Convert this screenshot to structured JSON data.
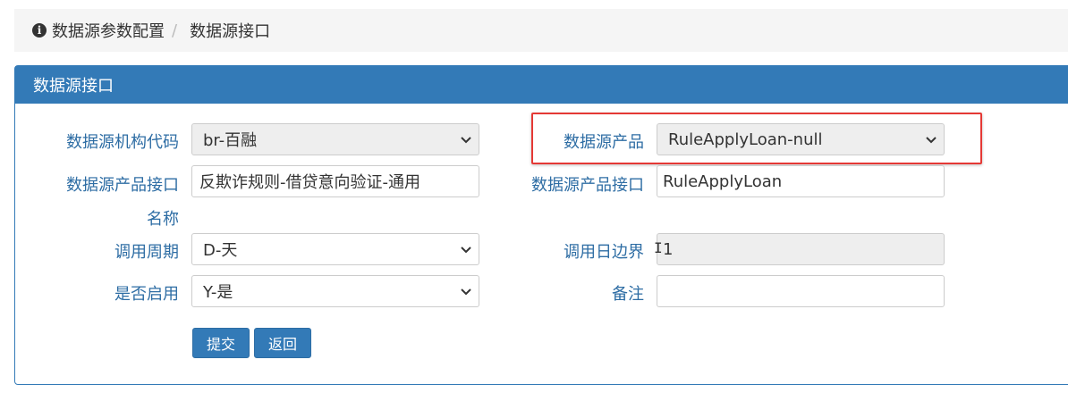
{
  "breadcrumb": {
    "parent": "数据源参数配置",
    "separator": "/",
    "current": "数据源接口"
  },
  "panel": {
    "title": "数据源接口"
  },
  "form": {
    "org_code": {
      "label": "数据源机构代码",
      "value": "br-百融"
    },
    "product": {
      "label": "数据源产品",
      "value": "RuleApplyLoan-null"
    },
    "interface_name": {
      "label_line1": "数据源产品接口",
      "label_line2": "名称",
      "value": "反欺诈规则-借贷意向验证-通用"
    },
    "interface": {
      "label": "数据源产品接口",
      "value": "RuleApplyLoan"
    },
    "period": {
      "label": "调用周期",
      "value": "D-天"
    },
    "day_boundary": {
      "label": "调用日边界",
      "value": "1"
    },
    "enabled": {
      "label": "是否启用",
      "value": "Y-是"
    },
    "remark": {
      "label": "备注",
      "value": ""
    }
  },
  "buttons": {
    "submit": "提交",
    "back": "返回"
  },
  "colors": {
    "primary": "#337ab7",
    "highlight": "#e53935",
    "label": "#2e6da4"
  }
}
